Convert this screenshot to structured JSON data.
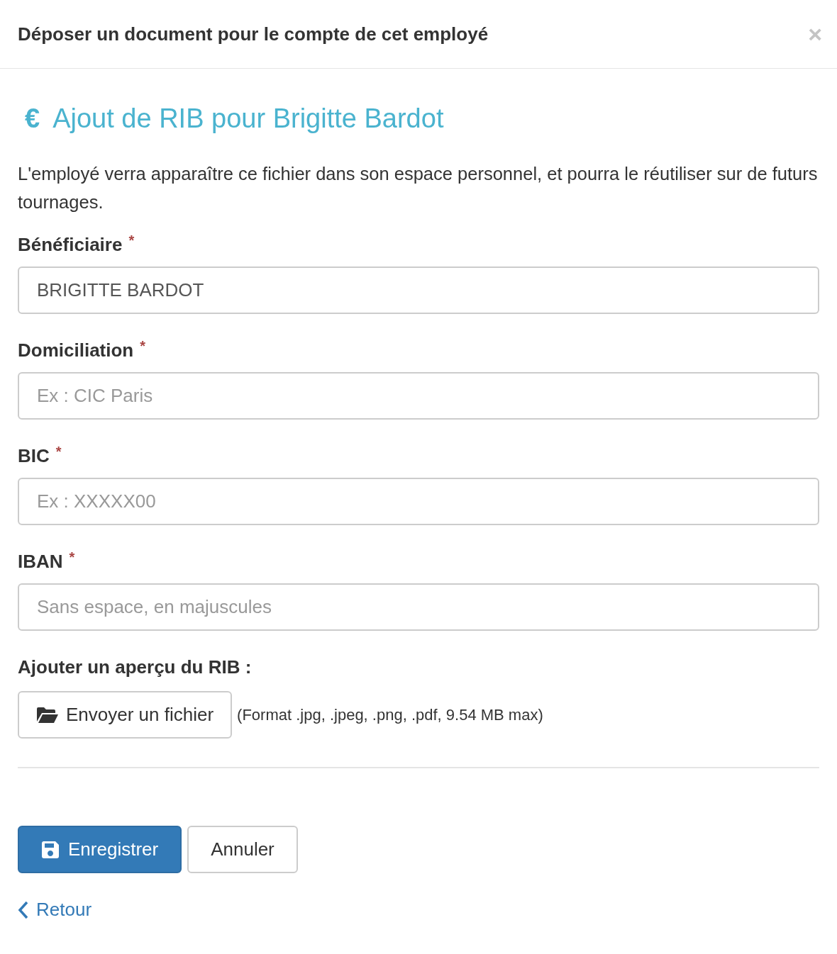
{
  "modal": {
    "title": "Déposer un document pour le compte de cet employé",
    "close": "×"
  },
  "heading": {
    "icon": "€",
    "text": "Ajout de RIB pour Brigitte Bardot"
  },
  "description": "L'employé verra apparaître ce fichier dans son espace personnel, et pourra le réutiliser sur de futurs tournages.",
  "fields": [
    {
      "label": "Bénéficiaire",
      "required_mark": "*",
      "value": "BRIGITTE BARDOT"
    },
    {
      "label": "Domiciliation",
      "required_mark": "*",
      "placeholder": "Ex : CIC Paris"
    },
    {
      "label": "BIC",
      "required_mark": "*",
      "placeholder": "Ex : XXXXX00"
    },
    {
      "label": "IBAN",
      "required_mark": "*",
      "placeholder": "Sans espace, en majuscules"
    }
  ],
  "upload": {
    "label": "Ajouter un aperçu du RIB :",
    "button": "Envoyer un fichier",
    "hint": "(Format .jpg, .jpeg, .png, .pdf, 9.54 MB max)"
  },
  "actions": [
    {
      "label": "Enregistrer",
      "kind": "primary"
    },
    {
      "label": "Annuler",
      "kind": "default"
    }
  ],
  "back_link": "Retour"
}
